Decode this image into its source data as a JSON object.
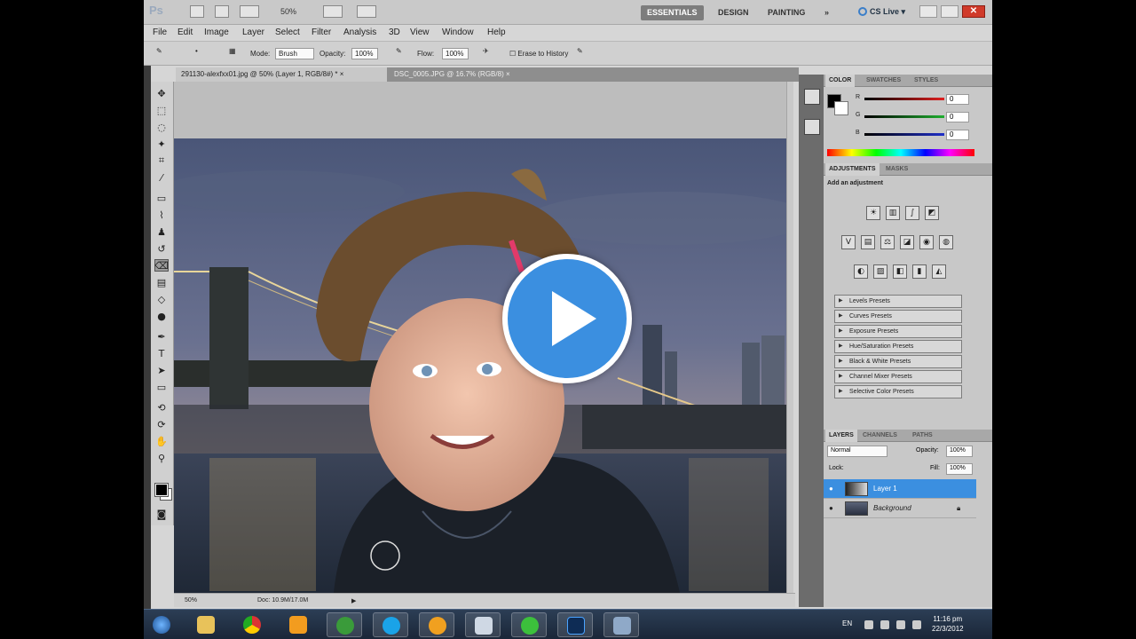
{
  "app": {
    "logo": "Ps",
    "zoom": "50%",
    "workspaces": [
      "ESSENTIALS",
      "DESIGN",
      "PAINTING"
    ],
    "more": "»",
    "cslive": "CS Live"
  },
  "menus": [
    "File",
    "Edit",
    "Image",
    "Layer",
    "Select",
    "Filter",
    "Analysis",
    "3D",
    "View",
    "Window",
    "Help"
  ],
  "options": {
    "mode_label": "Mode:",
    "mode_value": "Brush",
    "opacity_label": "Opacity:",
    "opacity_value": "100%",
    "flow_label": "Flow:",
    "flow_value": "100%",
    "erase_label": "Erase to History"
  },
  "tabs": [
    {
      "label": "291130-alexfxx01.jpg @ 50% (Layer 1, RGB/8#) *",
      "close": "×"
    },
    {
      "label": "DSC_0005.JPG @ 16.7% (RGB/8)",
      "close": "×"
    }
  ],
  "status": {
    "zoom": "50%",
    "doc": "Doc: 10.9M/17.0M"
  },
  "color_panel": {
    "tabs": [
      "COLOR",
      "SWATCHES",
      "STYLES"
    ],
    "channels": [
      {
        "label": "R",
        "value": "0",
        "color": "#e02020"
      },
      {
        "label": "G",
        "value": "0",
        "color": "#1fae2f"
      },
      {
        "label": "B",
        "value": "0",
        "color": "#1f2fc8"
      }
    ]
  },
  "adjustments_panel": {
    "tabs": [
      "ADJUSTMENTS",
      "MASKS"
    ],
    "title": "Add an adjustment",
    "presets": [
      "Levels Presets",
      "Curves Presets",
      "Exposure Presets",
      "Hue/Saturation Presets",
      "Black & White Presets",
      "Channel Mixer Presets",
      "Selective Color Presets"
    ]
  },
  "layers_panel": {
    "tabs": [
      "LAYERS",
      "CHANNELS",
      "PATHS"
    ],
    "blend_mode": "Normal",
    "opacity_label": "Opacity:",
    "opacity_value": "100%",
    "lock_label": "Lock:",
    "fill_label": "Fill:",
    "fill_value": "100%",
    "layers": [
      {
        "name": "Layer 1",
        "selected": true
      },
      {
        "name": "Background",
        "selected": false
      }
    ]
  },
  "taskbar": {
    "lang": "EN",
    "time": "11:16 pm",
    "date": "22/3/2012"
  },
  "colors": {
    "accent": "#3b8fe0",
    "close": "#d03a2a"
  }
}
